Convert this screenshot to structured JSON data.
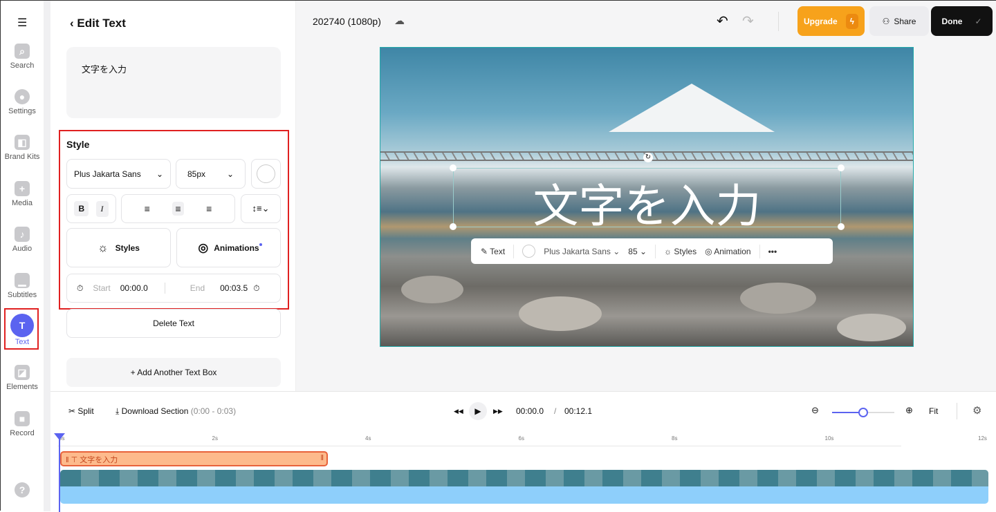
{
  "sidebar": {
    "items": [
      {
        "label": "Search",
        "icon": "search-icon"
      },
      {
        "label": "Settings",
        "icon": "gear-icon"
      },
      {
        "label": "Brand Kits",
        "icon": "brand-kit-icon"
      },
      {
        "label": "Media",
        "icon": "plus-icon"
      },
      {
        "label": "Audio",
        "icon": "music-icon"
      },
      {
        "label": "Subtitles",
        "icon": "subtitles-icon"
      },
      {
        "label": "Text",
        "icon": "text-icon",
        "active": true
      },
      {
        "label": "Elements",
        "icon": "elements-icon"
      },
      {
        "label": "Record",
        "icon": "record-icon"
      }
    ]
  },
  "panel": {
    "title": "Edit Text",
    "text_value": "文字を入力",
    "style_heading": "Style",
    "font": "Plus Jakarta Sans",
    "size": "85px",
    "bold": "B",
    "italic": "I",
    "styles_label": "Styles",
    "animations_label": "Animations",
    "start_label": "Start",
    "start_value": "00:00.0",
    "end_label": "End",
    "end_value": "00:03.5",
    "delete_label": "Delete Text",
    "add_label": "+  Add Another Text Box"
  },
  "header": {
    "project": "202740 (1080p)",
    "upgrade": "Upgrade",
    "share": "Share",
    "done": "Done"
  },
  "canvas": {
    "overlay_text": "文字を入力",
    "toolbar": {
      "text": "Text",
      "font": "Plus Jakarta Sans",
      "size": "85",
      "styles": "Styles",
      "animation": "Animation",
      "more": "•••"
    }
  },
  "timeline": {
    "split": "Split",
    "download": "Download Section",
    "range": "(0:00 - 0:03)",
    "current": "00:00.0",
    "separator": "/",
    "total": "00:12.1",
    "fit": "Fit",
    "zoom_level": 0.5,
    "ticks": [
      "0s",
      "2s",
      "4s",
      "6s",
      "8s",
      "10s",
      "12s"
    ],
    "clip_text": "文字を入力"
  },
  "colors": {
    "accent": "#5b63f0",
    "upgrade": "#f7a21b",
    "done": "#111111",
    "highlight": "#e02020",
    "clip": "#fdba8c"
  }
}
